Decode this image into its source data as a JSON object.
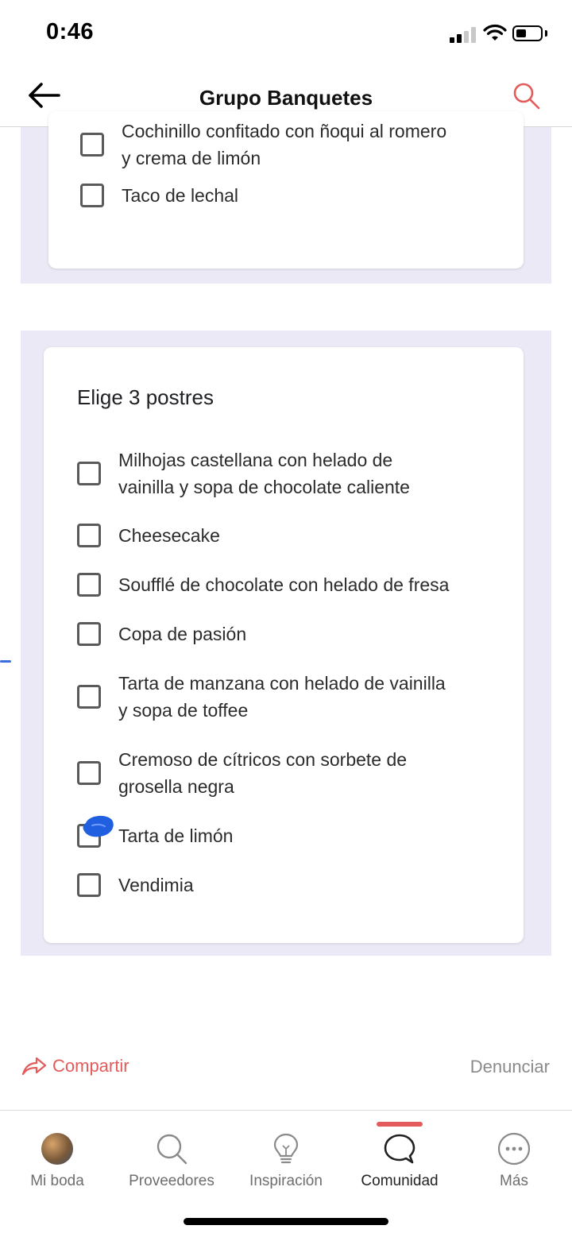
{
  "status_bar": {
    "time": "0:46"
  },
  "header": {
    "title": "Grupo Banquetes"
  },
  "first_question": {
    "options": [
      {
        "label": "Cochinillo confitado con ñoqui al romero\ny crema de limón",
        "checked": false
      },
      {
        "label": "Taco de lechal",
        "checked": false
      }
    ]
  },
  "dessert_question": {
    "title": "Elige 3 postres",
    "options": [
      {
        "label": "Milhojas castellana con helado de\nvainilla y sopa de chocolate caliente",
        "checked": false
      },
      {
        "label": "Cheesecake",
        "checked": false
      },
      {
        "label": "Soufflé de chocolate con helado de fresa",
        "checked": false
      },
      {
        "label": "Copa de pasión",
        "checked": false
      },
      {
        "label": "Tarta de manzana con helado de vainilla\ny sopa de toffee",
        "checked": false
      },
      {
        "label": "Cremoso de cítricos con sorbete de\ngrosella negra",
        "checked": false
      },
      {
        "label": "Tarta de limón",
        "checked": false,
        "hand_marked": true
      },
      {
        "label": "Vendimia",
        "checked": false
      }
    ]
  },
  "actions": {
    "share_label": "Compartir",
    "report_label": "Denunciar"
  },
  "bottom_nav": {
    "items": [
      {
        "label": "Mi boda",
        "icon": "avatar-icon"
      },
      {
        "label": "Proveedores",
        "icon": "search-icon"
      },
      {
        "label": "Inspiración",
        "icon": "lightbulb-icon"
      },
      {
        "label": "Comunidad",
        "icon": "chat-bubble-icon",
        "active": true
      },
      {
        "label": "Más",
        "icon": "more-icon"
      }
    ]
  },
  "colors": {
    "accent": "#e35b5b",
    "form_background": "#ebe9f5",
    "ink_mark": "#1f5fe0"
  }
}
